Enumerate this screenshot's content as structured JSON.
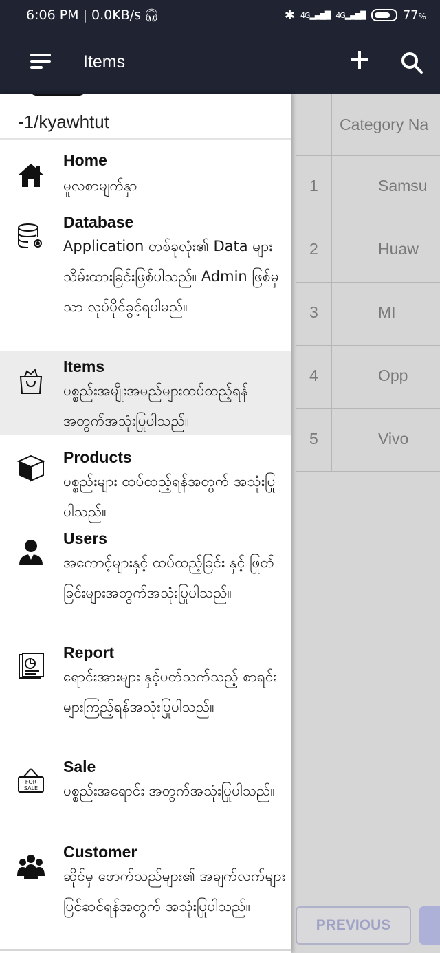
{
  "status_bar": {
    "time_network": "6:06 PM | 0.0KB/s",
    "network_type_1": "4G",
    "network_type_2": "4G",
    "battery": "77",
    "battery_unit": "%"
  },
  "app_bar": {
    "title": "Items",
    "menu_icon": "menu-icon",
    "add_icon": "add-icon",
    "search_icon": "search-icon"
  },
  "drawer": {
    "username": "-1/kyawhtut",
    "items": [
      {
        "icon": "home-icon",
        "title": "Home",
        "desc": "မူလစာမျက်နှာ"
      },
      {
        "icon": "database-settings-icon",
        "title": "Database",
        "desc": "Application တစ်ခုလုံး၏ Data များသိမ်းထားခြင်းဖြစ်ပါသည်။ Admin ဖြစ်မှသာ လုပ်ပိုင်ခွင့်ရပါမည်။"
      },
      {
        "icon": "shopping-bag-icon",
        "title": "Items",
        "desc": "ပစ္စည်းအမျိုးအမည်များထပ်ထည့်ရန်အတွက်အသုံးပြုပါသည်။",
        "active": true
      },
      {
        "icon": "box-icon",
        "title": "Products",
        "desc": "ပစ္စည်းများ ထပ်ထည့်ရန်အတွက် အသုံးပြုပါသည်။"
      },
      {
        "icon": "user-icon",
        "title": "Users",
        "desc": "အကောင့်များနှင့် ထပ်ထည့်ခြင်း နှင့် ဖြုတ်ခြင်းများအတွက်အသုံးပြုပါသည်။"
      },
      {
        "icon": "report-icon",
        "title": "Report",
        "desc": "ရောင်းအားများ နှင့်ပတ်သက်သည့် စာရင်းများကြည့်ရန်အသုံးပြုပါသည်။"
      },
      {
        "icon": "for-sale-sign-icon",
        "title": "Sale",
        "desc": "ပစ္စည်းအရောင်း အတွက်အသုံးပြုပါသည်။"
      },
      {
        "icon": "customers-icon",
        "title": "Customer",
        "desc": "ဆိုင်မှ ဖောက်သည်များ၏ အချက်လက်များ ပြင်ဆင်ရန်အတွက် အသုံးပြုပါသည်။"
      }
    ]
  },
  "table": {
    "column_header": "Category Na",
    "rows": [
      {
        "index": "1",
        "category": "Samsu"
      },
      {
        "index": "2",
        "category": "Huaw"
      },
      {
        "index": "3",
        "category": "MI"
      },
      {
        "index": "4",
        "category": "Opp"
      },
      {
        "index": "5",
        "category": "Vivo"
      }
    ],
    "previous_label": "PREVIOUS"
  },
  "colors": {
    "app_bar": "#1f2332",
    "drawer_active": "#ececec",
    "button_text": "#b6b9e0"
  }
}
